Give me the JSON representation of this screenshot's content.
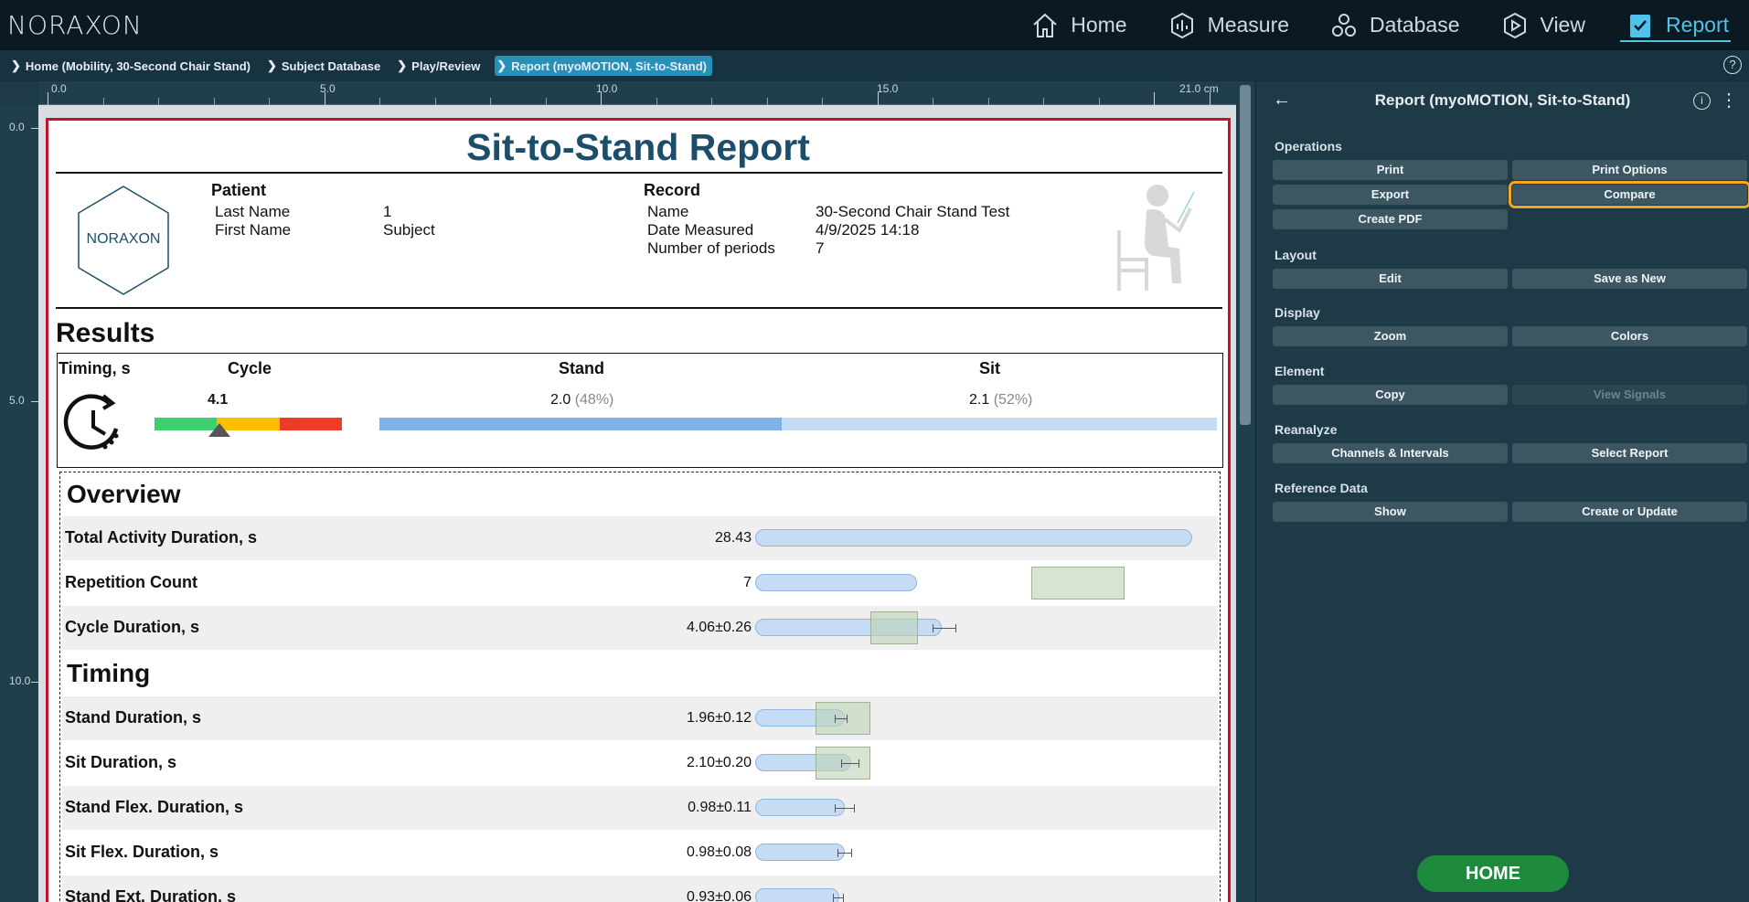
{
  "app": {
    "logo": "NORAXON"
  },
  "nav": [
    {
      "label": "Home",
      "icon": "home-icon"
    },
    {
      "label": "Measure",
      "icon": "measure-icon"
    },
    {
      "label": "Database",
      "icon": "database-icon"
    },
    {
      "label": "View",
      "icon": "play-icon"
    },
    {
      "label": "Report",
      "icon": "report-icon",
      "active": true
    }
  ],
  "breadcrumb": [
    "Home (Mobility, 30-Second Chair Stand)",
    "Subject Database",
    "Play/Review",
    "Report (myoMOTION, Sit-to-Stand)"
  ],
  "ruler": {
    "top_labels": [
      "0.0",
      "5.0",
      "10.0",
      "15.0",
      "21.0 cm"
    ],
    "left_labels": [
      "0.0",
      "5.0",
      "10.0"
    ]
  },
  "report": {
    "title": "Sit-to-Stand Report",
    "logo_text": "NORAXON",
    "patient_heading": "Patient",
    "patient": [
      {
        "label": "Last Name",
        "value": "1"
      },
      {
        "label": "First Name",
        "value": "Subject"
      }
    ],
    "record_heading": "Record",
    "record": [
      {
        "label": "Name",
        "value": "30-Second Chair Stand Test"
      },
      {
        "label": "Date Measured",
        "value": "4/9/2025 14:18"
      },
      {
        "label": "Number of periods",
        "value": "7"
      }
    ],
    "results_heading": "Results",
    "timing": {
      "label": "Timing, s",
      "cycle_heading": "Cycle",
      "stand_heading": "Stand",
      "sit_heading": "Sit",
      "cycle_value": "4.1",
      "stand_value": "2.0",
      "stand_pct": "(48%)",
      "sit_value": "2.1",
      "sit_pct": "(52%)",
      "stand_fraction": 0.48,
      "colors": {
        "green": "#3ecf6e",
        "yellow": "#ffbf00",
        "red": "#f03a2a",
        "stand": "#7fb2e6",
        "sit": "#c5dcf4"
      }
    },
    "overview_heading": "Overview",
    "overview_rows": [
      {
        "label": "Total Activity Duration, s",
        "value": "28.43"
      },
      {
        "label": "Repetition Count",
        "value": "7"
      },
      {
        "label": "Cycle Duration, s",
        "value": "4.06±0.26"
      }
    ],
    "timing_heading": "Timing",
    "timing_rows": [
      {
        "label": "Stand Duration, s",
        "value": "1.96±0.12"
      },
      {
        "label": "Sit Duration, s",
        "value": "2.10±0.20"
      },
      {
        "label": "Stand Flex. Duration, s",
        "value": "0.98±0.11"
      },
      {
        "label": "Sit Flex. Duration, s",
        "value": "0.98±0.08"
      },
      {
        "label": "Stand Ext. Duration, s",
        "value": "0.93±0.06"
      }
    ]
  },
  "panel": {
    "title": "Report (myoMOTION, Sit-to-Stand)",
    "sections": {
      "operations": "Operations",
      "layout": "Layout",
      "display": "Display",
      "element": "Element",
      "reanalyze": "Reanalyze",
      "reference": "Reference Data"
    },
    "buttons": {
      "print": "Print",
      "print_options": "Print Options",
      "export": "Export",
      "compare": "Compare",
      "create_pdf": "Create PDF",
      "edit": "Edit",
      "save_as_new": "Save as New",
      "zoom": "Zoom",
      "colors": "Colors",
      "copy": "Copy",
      "view_signals": "View Signals",
      "channels": "Channels & Intervals",
      "select_report": "Select Report",
      "show": "Show",
      "create_update": "Create or Update"
    },
    "home_button": "HOME"
  }
}
